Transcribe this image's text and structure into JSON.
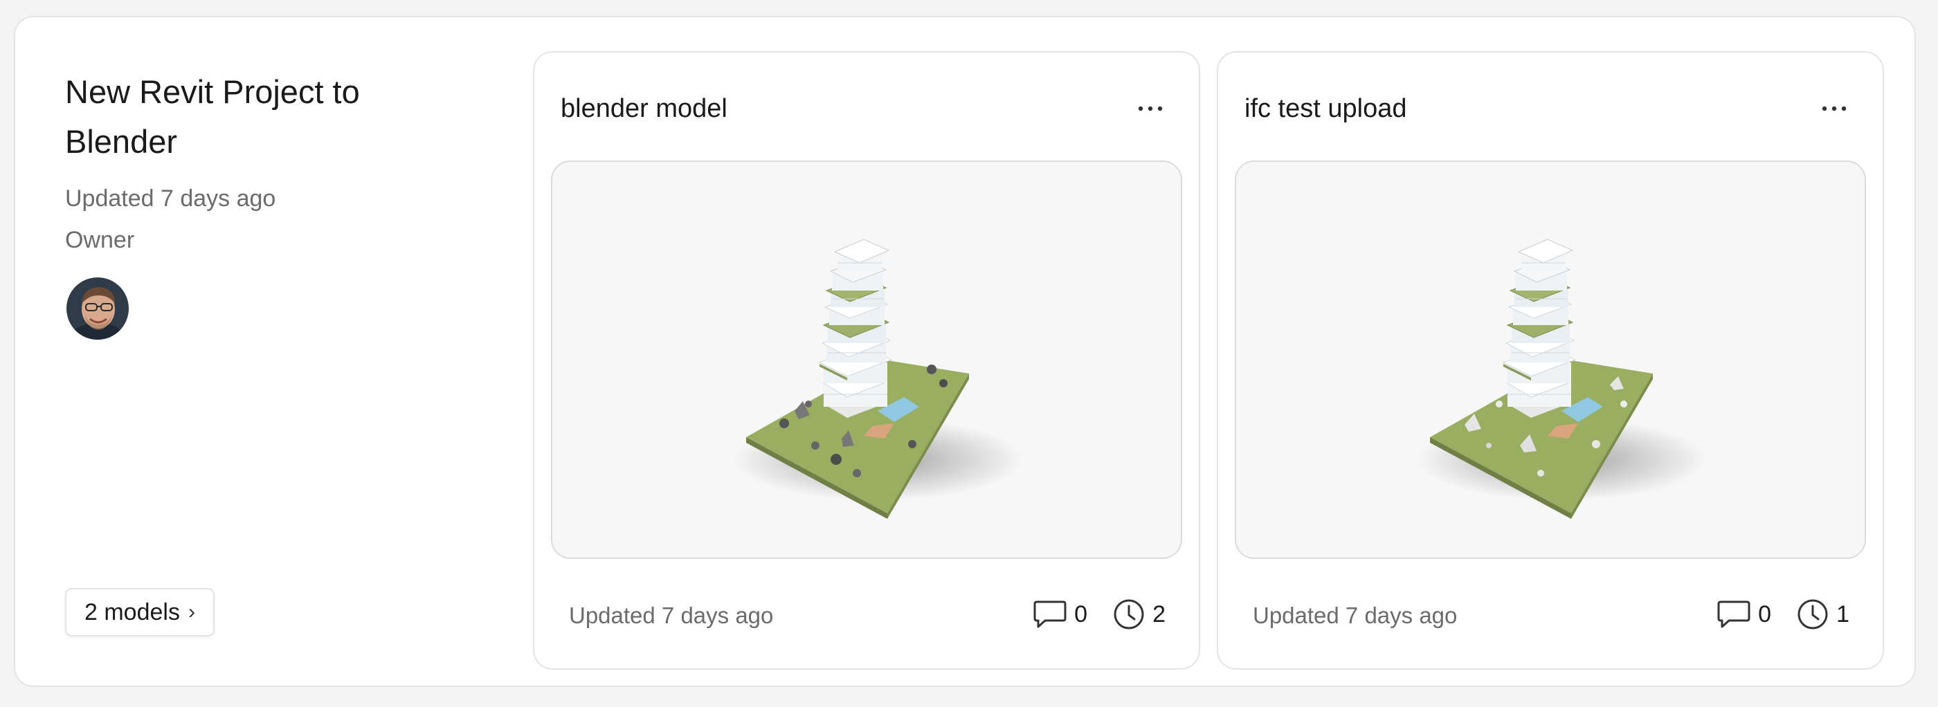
{
  "project": {
    "title": "New Revit Project to Blender",
    "updated": "Updated 7 days ago",
    "role": "Owner",
    "models_button": "2 models",
    "models_chevron": "›"
  },
  "models": [
    {
      "name": "blender model",
      "updated": "Updated 7 days ago",
      "comments": "0",
      "versions": "2"
    },
    {
      "name": "ifc test upload",
      "updated": "Updated 7 days ago",
      "comments": "0",
      "versions": "1"
    }
  ],
  "icons": {
    "more": "more-horizontal-icon",
    "comment": "comment-icon",
    "versions": "clock-icon"
  },
  "colors": {
    "grass": "#9aae62",
    "building": "#ffffff",
    "pool": "#8fc8e0",
    "text_muted": "#6b6b6b"
  }
}
